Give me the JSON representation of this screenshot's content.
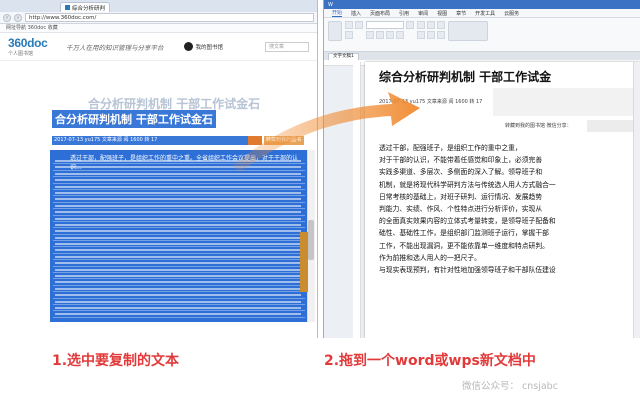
{
  "browser": {
    "tab_label": "综合分析研判",
    "url": "http://www.360doc.com/",
    "favbar": "网址导航  360doc  收藏",
    "nav_back": "‹",
    "nav_fwd": "›",
    "site_logo": "360doc",
    "site_logo_sub": "个人图书馆",
    "slogan": "千万人在用的知识管理与分享平台",
    "my_library": "我的图书馆",
    "search_placeholder": "搜文章",
    "doc_title": "合分析研判机制  干部工作试金石",
    "doc_meta": "2017-07-13  yu175  文章来源  阅 1600  转 17",
    "share_label": "转藏到我的图书馆",
    "selected_excerpt": "透过干部，配强班子，是组织工作的重中之重。全省组织工作会议提出，对于干部的认识..."
  },
  "wps": {
    "title_items": [
      "开始",
      "插入",
      "页面布局",
      "引用",
      "审阅",
      "视图",
      "章节",
      "开发工具",
      "云服务"
    ],
    "active_menu": "开始",
    "doc_tab": "文字文稿1",
    "page_title": "综合分析研判机制  干部工作试金",
    "page_meta": "2017-07-13  yu175  文章来源  阅 1600  转 17",
    "page_meta2": "转藏到我的图书馆  微信分享：",
    "paragraphs": [
      "透过干部，配强班子，是组织工作的重中之重，",
      "对于干部的认识，不能带着任感觉和印象上，必须完善",
      "实践多渠道、多层次、多侧面的深入了解。领导班子和",
      "机制，就是将现代科学研判方法与传统选人用人方式融合一",
      "日常考核的基础上，对班子研判、运行情况、发展趋势",
      "判能力、实绩、作风、个性特点进行分析评价，实现从",
      "的全面真实效果内容的立体式考量转变，是领导班子配备和",
      "础性、基础性工作，是组织部门监测班子运行，掌握干部",
      "工作，不能出现漏洞，更不能依靠单一维度和特点研判。",
      "作为前推和选人用人的一把尺子。",
      "与现实表现预判，有针对性地加强领导班子和干部队伍建设"
    ]
  },
  "captions": {
    "step1": "1.选中要复制的文本",
    "step2": "2.拖到一个word或wps新文档中",
    "wechat": "微信公众号：  cnsjabc"
  },
  "colors": {
    "selection": "#2d6fd6",
    "caption": "#e23a3a",
    "arrow": "#f0892e"
  }
}
